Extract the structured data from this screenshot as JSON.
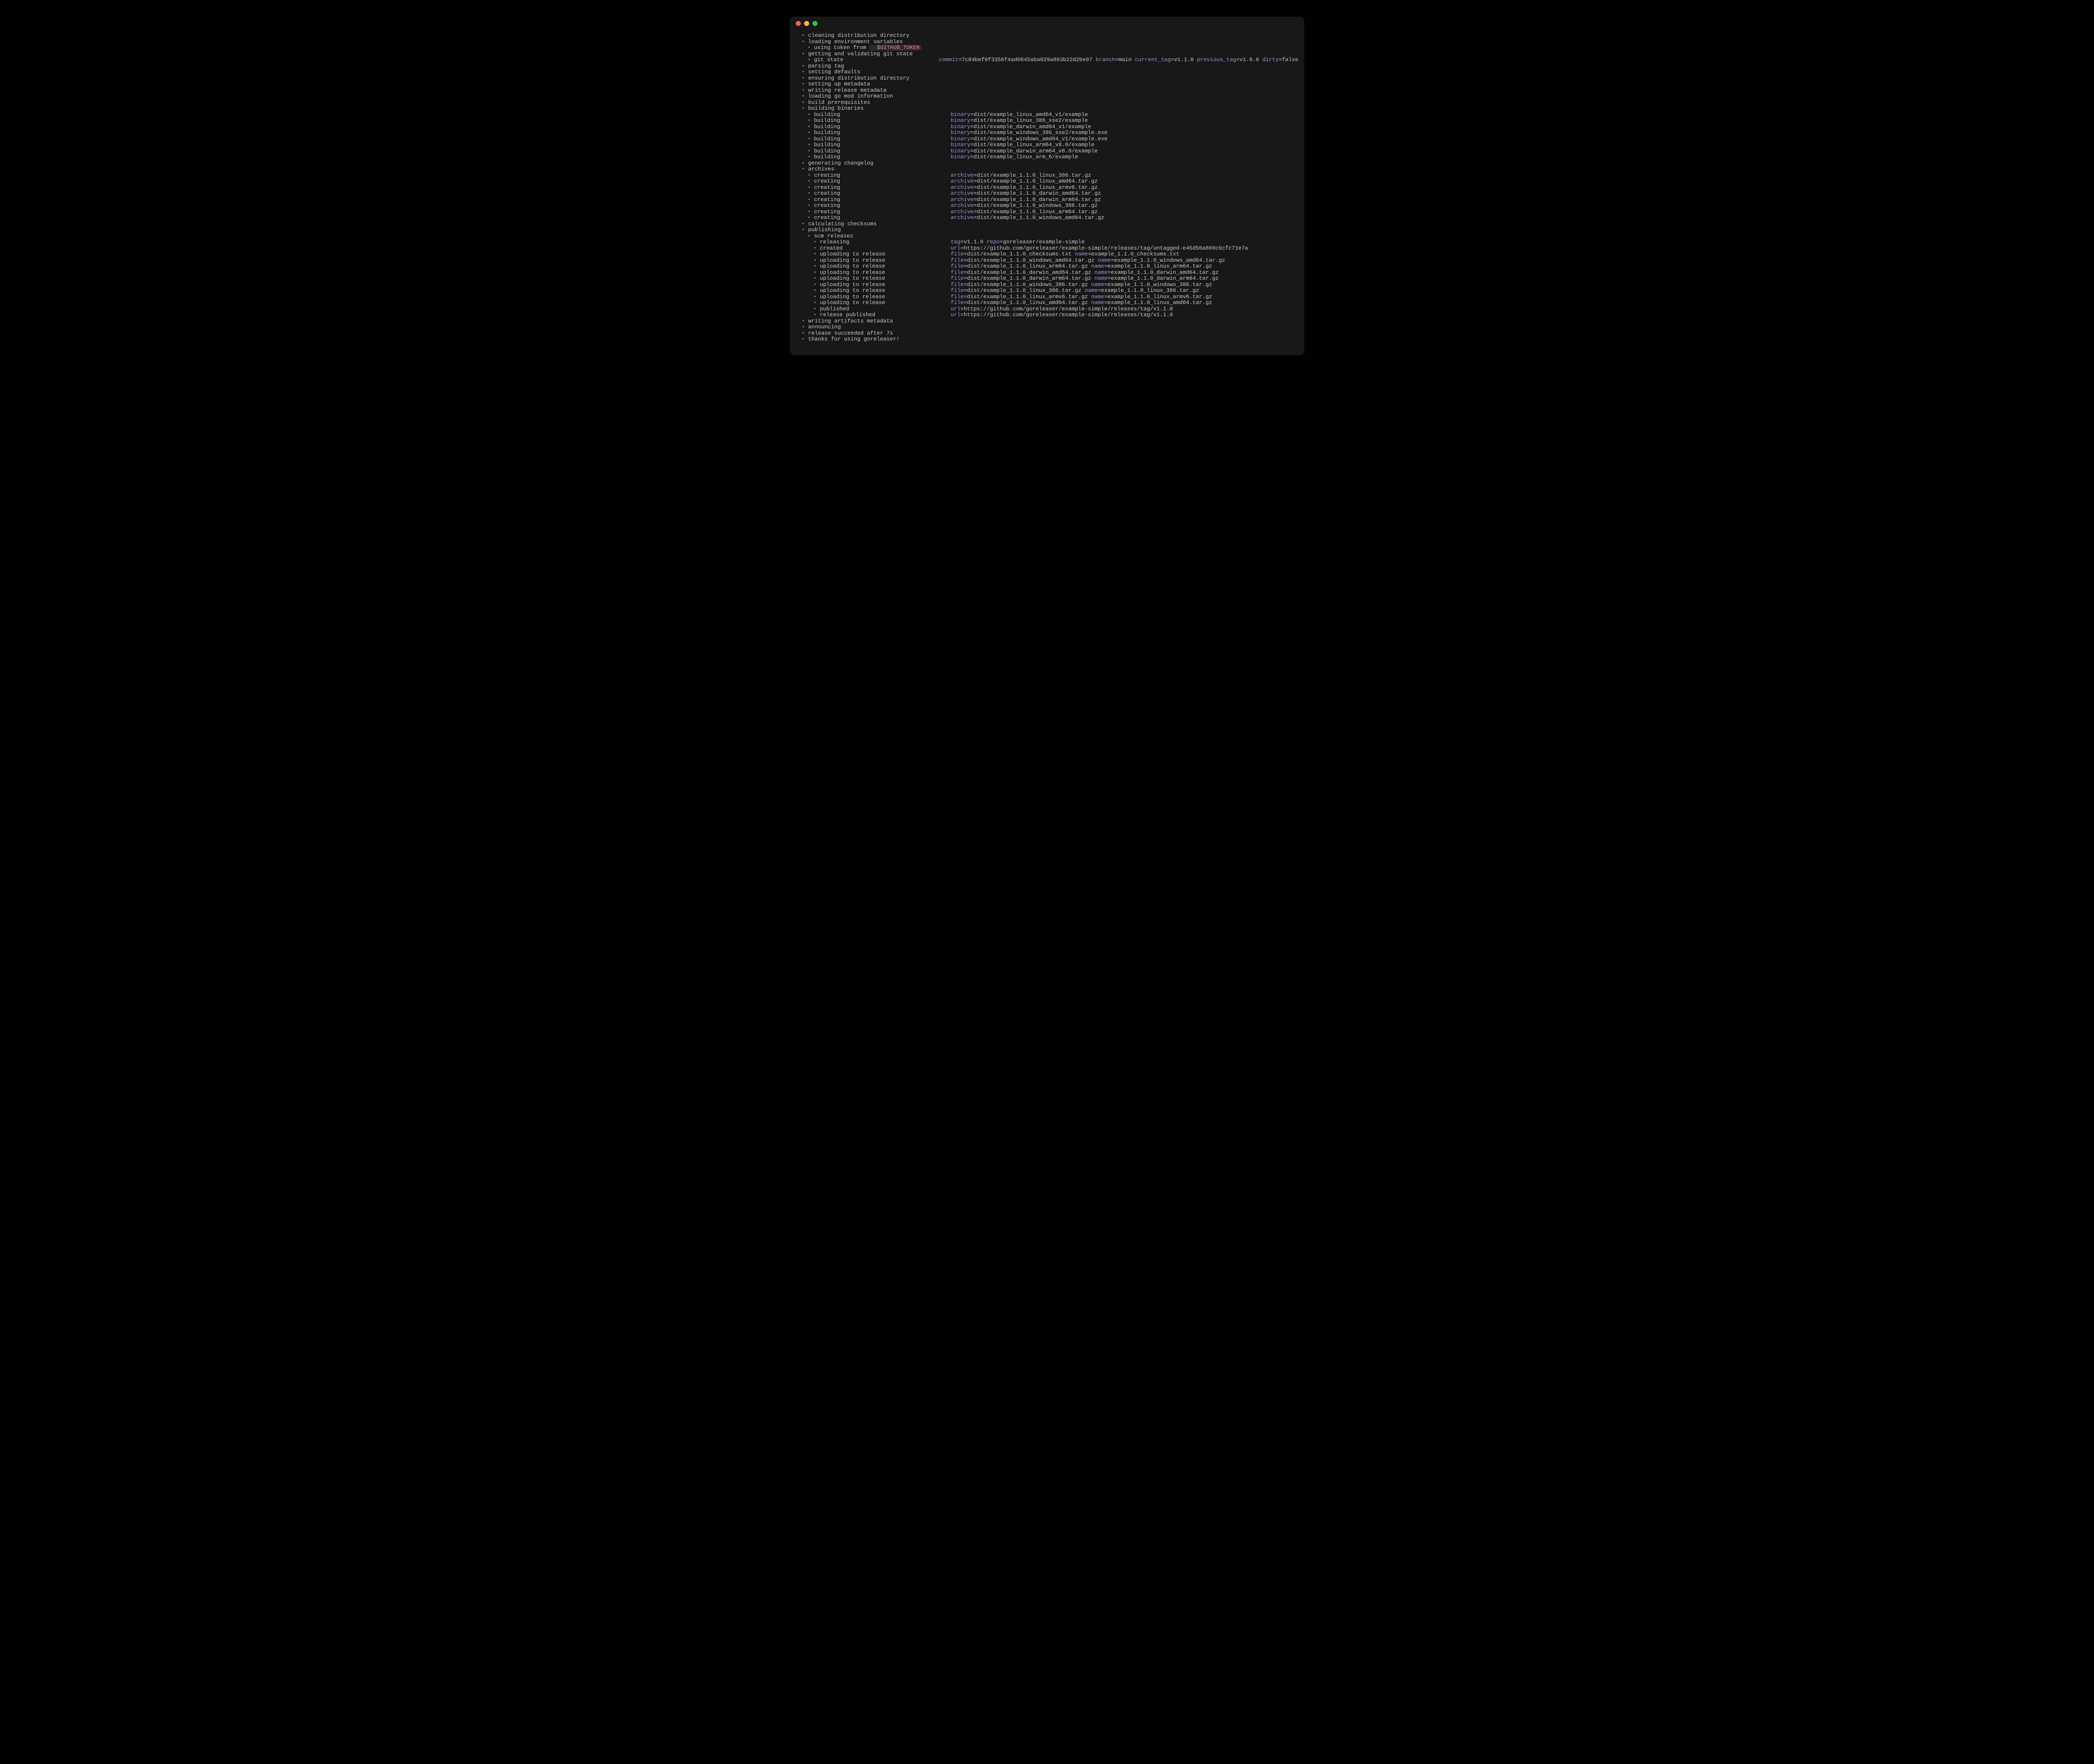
{
  "colors": {
    "bullet": "#7a7ab8",
    "key": "#9e95d6",
    "text": "#c9c9c9",
    "codebg": "#2b2b2d",
    "token": "#ff7b96",
    "windowbg": "#171718"
  },
  "traffic_lights": {
    "close": "close-window",
    "minimize": "minimize-window",
    "zoom": "zoom-window"
  },
  "symbols": {
    "bullet": "• "
  },
  "lines": [
    {
      "indent": 0,
      "msg": "cleaning distribution directory"
    },
    {
      "indent": 0,
      "msg": "loading environment variables"
    },
    {
      "indent": 1,
      "msg": "using token from ",
      "code_prefix": " ",
      "code_token": "$GITHUB_TOKEN"
    },
    {
      "indent": 0,
      "msg": "getting and validating git state"
    },
    {
      "indent": 1,
      "msg": "git state",
      "kv": [
        [
          "commit",
          "7c84bef9f3356f4ad0645aba029a893b22d2be07"
        ],
        [
          "branch",
          "main"
        ],
        [
          "current_tag",
          "v1.1.0"
        ],
        [
          "previous_tag",
          "v1.0.0"
        ],
        [
          "dirty",
          "false"
        ]
      ]
    },
    {
      "indent": 0,
      "msg": "parsing tag"
    },
    {
      "indent": 0,
      "msg": "setting defaults"
    },
    {
      "indent": 0,
      "msg": "ensuring distribution directory"
    },
    {
      "indent": 0,
      "msg": "setting up metadata"
    },
    {
      "indent": 0,
      "msg": "writing release metadata"
    },
    {
      "indent": 0,
      "msg": "loading go mod information"
    },
    {
      "indent": 0,
      "msg": "build prerequisites"
    },
    {
      "indent": 0,
      "msg": "building binaries"
    },
    {
      "indent": 1,
      "msg": "building",
      "kv": [
        [
          "binary",
          "dist/example_linux_amd64_v1/example"
        ]
      ]
    },
    {
      "indent": 1,
      "msg": "building",
      "kv": [
        [
          "binary",
          "dist/example_linux_386_sse2/example"
        ]
      ]
    },
    {
      "indent": 1,
      "msg": "building",
      "kv": [
        [
          "binary",
          "dist/example_darwin_amd64_v1/example"
        ]
      ]
    },
    {
      "indent": 1,
      "msg": "building",
      "kv": [
        [
          "binary",
          "dist/example_windows_386_sse2/example.exe"
        ]
      ]
    },
    {
      "indent": 1,
      "msg": "building",
      "kv": [
        [
          "binary",
          "dist/example_windows_amd64_v1/example.exe"
        ]
      ]
    },
    {
      "indent": 1,
      "msg": "building",
      "kv": [
        [
          "binary",
          "dist/example_linux_arm64_v8.0/example"
        ]
      ]
    },
    {
      "indent": 1,
      "msg": "building",
      "kv": [
        [
          "binary",
          "dist/example_darwin_arm64_v8.0/example"
        ]
      ]
    },
    {
      "indent": 1,
      "msg": "building",
      "kv": [
        [
          "binary",
          "dist/example_linux_arm_6/example"
        ]
      ]
    },
    {
      "indent": 0,
      "msg": "generating changelog"
    },
    {
      "indent": 0,
      "msg": "archives"
    },
    {
      "indent": 1,
      "msg": "creating",
      "kv": [
        [
          "archive",
          "dist/example_1.1.0_linux_386.tar.gz"
        ]
      ]
    },
    {
      "indent": 1,
      "msg": "creating",
      "kv": [
        [
          "archive",
          "dist/example_1.1.0_linux_amd64.tar.gz"
        ]
      ]
    },
    {
      "indent": 1,
      "msg": "creating",
      "kv": [
        [
          "archive",
          "dist/example_1.1.0_linux_armv6.tar.gz"
        ]
      ]
    },
    {
      "indent": 1,
      "msg": "creating",
      "kv": [
        [
          "archive",
          "dist/example_1.1.0_darwin_amd64.tar.gz"
        ]
      ]
    },
    {
      "indent": 1,
      "msg": "creating",
      "kv": [
        [
          "archive",
          "dist/example_1.1.0_darwin_arm64.tar.gz"
        ]
      ]
    },
    {
      "indent": 1,
      "msg": "creating",
      "kv": [
        [
          "archive",
          "dist/example_1.1.0_windows_386.tar.gz"
        ]
      ]
    },
    {
      "indent": 1,
      "msg": "creating",
      "kv": [
        [
          "archive",
          "dist/example_1.1.0_linux_arm64.tar.gz"
        ]
      ]
    },
    {
      "indent": 1,
      "msg": "creating",
      "kv": [
        [
          "archive",
          "dist/example_1.1.0_windows_amd64.tar.gz"
        ]
      ]
    },
    {
      "indent": 0,
      "msg": "calculating checksums"
    },
    {
      "indent": 0,
      "msg": "publishing"
    },
    {
      "indent": 1,
      "msg": "scm releases"
    },
    {
      "indent": 2,
      "msg": "releasing",
      "kv": [
        [
          "tag",
          "v1.1.0"
        ],
        [
          "repo",
          "goreleaser/example-simple"
        ]
      ]
    },
    {
      "indent": 2,
      "msg": "created",
      "kv": [
        [
          "url",
          "https://github.com/goreleaser/example-simple/releases/tag/untagged-e45d56a869cbcfc71e7a"
        ]
      ]
    },
    {
      "indent": 2,
      "msg": "uploading to release",
      "kv": [
        [
          "file",
          "dist/example_1.1.0_checksums.txt"
        ],
        [
          "name",
          "example_1.1.0_checksums.txt"
        ]
      ]
    },
    {
      "indent": 2,
      "msg": "uploading to release",
      "kv": [
        [
          "file",
          "dist/example_1.1.0_windows_amd64.tar.gz"
        ],
        [
          "name",
          "example_1.1.0_windows_amd64.tar.gz"
        ]
      ]
    },
    {
      "indent": 2,
      "msg": "uploading to release",
      "kv": [
        [
          "file",
          "dist/example_1.1.0_linux_arm64.tar.gz"
        ],
        [
          "name",
          "example_1.1.0_linux_arm64.tar.gz"
        ]
      ]
    },
    {
      "indent": 2,
      "msg": "uploading to release",
      "kv": [
        [
          "file",
          "dist/example_1.1.0_darwin_amd64.tar.gz"
        ],
        [
          "name",
          "example_1.1.0_darwin_amd64.tar.gz"
        ]
      ]
    },
    {
      "indent": 2,
      "msg": "uploading to release",
      "kv": [
        [
          "file",
          "dist/example_1.1.0_darwin_arm64.tar.gz"
        ],
        [
          "name",
          "example_1.1.0_darwin_arm64.tar.gz"
        ]
      ]
    },
    {
      "indent": 2,
      "msg": "uploading to release",
      "kv": [
        [
          "file",
          "dist/example_1.1.0_windows_386.tar.gz"
        ],
        [
          "name",
          "example_1.1.0_windows_386.tar.gz"
        ]
      ]
    },
    {
      "indent": 2,
      "msg": "uploading to release",
      "kv": [
        [
          "file",
          "dist/example_1.1.0_linux_386.tar.gz"
        ],
        [
          "name",
          "example_1.1.0_linux_386.tar.gz"
        ]
      ]
    },
    {
      "indent": 2,
      "msg": "uploading to release",
      "kv": [
        [
          "file",
          "dist/example_1.1.0_linux_armv6.tar.gz"
        ],
        [
          "name",
          "example_1.1.0_linux_armv6.tar.gz"
        ]
      ]
    },
    {
      "indent": 2,
      "msg": "uploading to release",
      "kv": [
        [
          "file",
          "dist/example_1.1.0_linux_amd64.tar.gz"
        ],
        [
          "name",
          "example_1.1.0_linux_amd64.tar.gz"
        ]
      ]
    },
    {
      "indent": 2,
      "msg": "published",
      "kv": [
        [
          "url",
          "https://github.com/goreleaser/example-simple/releases/tag/v1.1.0"
        ]
      ]
    },
    {
      "indent": 2,
      "msg": "release published",
      "kv": [
        [
          "url",
          "https://github.com/goreleaser/example-simple/releases/tag/v1.1.0"
        ]
      ]
    },
    {
      "indent": 0,
      "msg": "writing artifacts metadata"
    },
    {
      "indent": 0,
      "msg": "announcing"
    },
    {
      "indent": 0,
      "msg": "release succeeded after 7s"
    },
    {
      "indent": 0,
      "msg": "thanks for using goreleaser!"
    }
  ]
}
